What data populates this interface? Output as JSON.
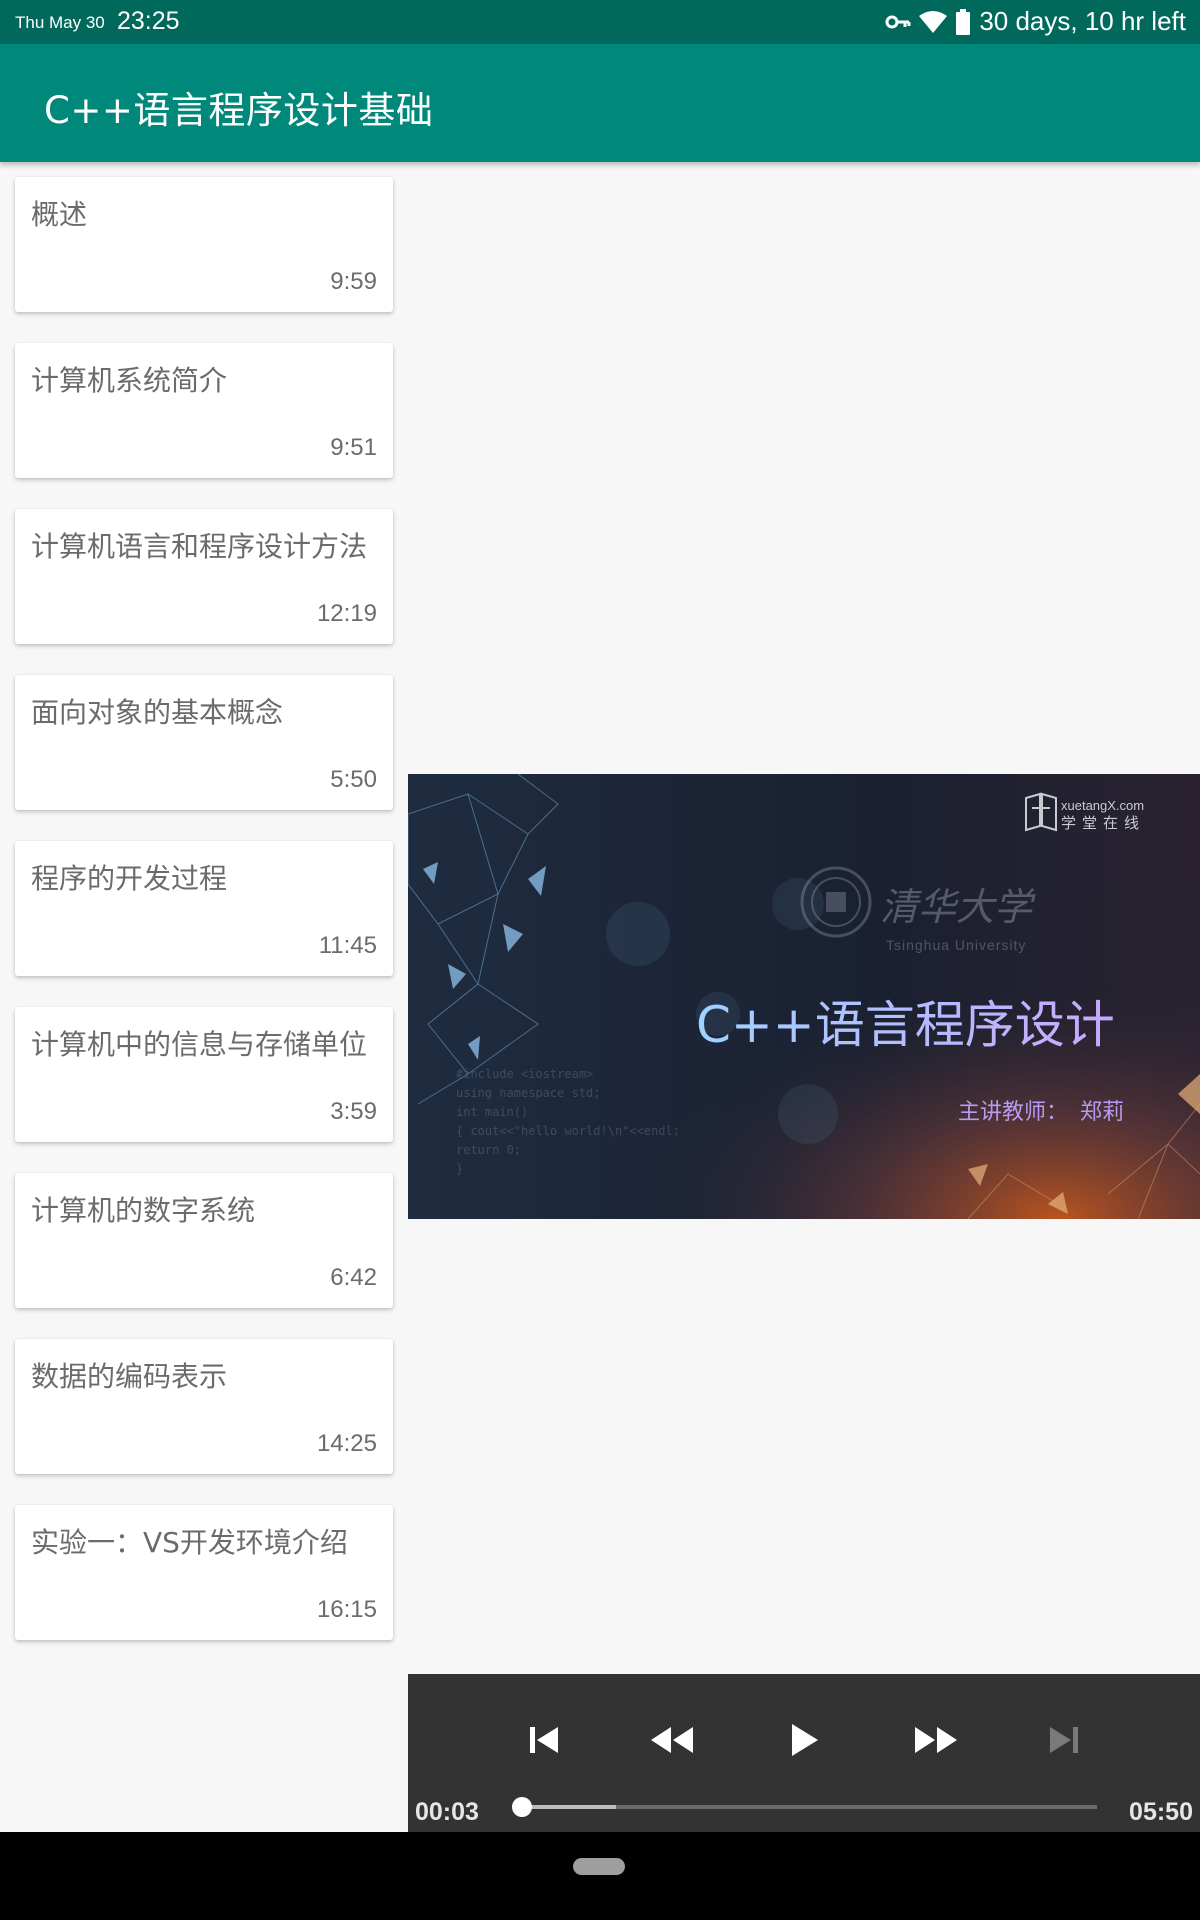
{
  "status_bar": {
    "date": "Thu May 30",
    "time": "23:25",
    "battery_text": "30 days, 10 hr left",
    "icons": [
      "vpn-key-icon",
      "wifi-icon",
      "battery-icon"
    ]
  },
  "app_bar": {
    "title": "C++语言程序设计基础"
  },
  "lessons": [
    {
      "title": "概述",
      "duration": "9:59"
    },
    {
      "title": "计算机系统简介",
      "duration": "9:51"
    },
    {
      "title": "计算机语言和程序设计方法",
      "duration": "12:19"
    },
    {
      "title": "面向对象的基本概念",
      "duration": "5:50"
    },
    {
      "title": "程序的开发过程",
      "duration": "11:45"
    },
    {
      "title": "计算机中的信息与存储单位",
      "duration": "3:59"
    },
    {
      "title": "计算机的数字系统",
      "duration": "6:42"
    },
    {
      "title": "数据的编码表示",
      "duration": "14:25"
    },
    {
      "title": "实验一：VS开发环境介绍",
      "duration": "16:15"
    }
  ],
  "video": {
    "course_title": "C++语言程序设计",
    "teacher_label": "主讲教师：",
    "teacher_name": "郑莉",
    "brand_url": "xuetangX.com",
    "brand_name": "学堂在线",
    "university": "清华大学",
    "university_en": "Tsinghua University",
    "code_lines": [
      "#include <iostream>",
      "using namespace std;",
      "int main()",
      "{     cout<<\"hello world!\\n\"<<endl;",
      "      return 0;",
      "}"
    ]
  },
  "player": {
    "current_time": "00:03",
    "total_time": "05:50",
    "progress_fraction": 0.0086,
    "buffered_fraction": 0.17,
    "buttons": [
      "previous",
      "rewind",
      "play",
      "fast-forward",
      "next"
    ]
  },
  "colors": {
    "status_bar": "#00695c",
    "app_bar": "#00897b",
    "background": "#f7f7f7",
    "controls": "#333333"
  }
}
